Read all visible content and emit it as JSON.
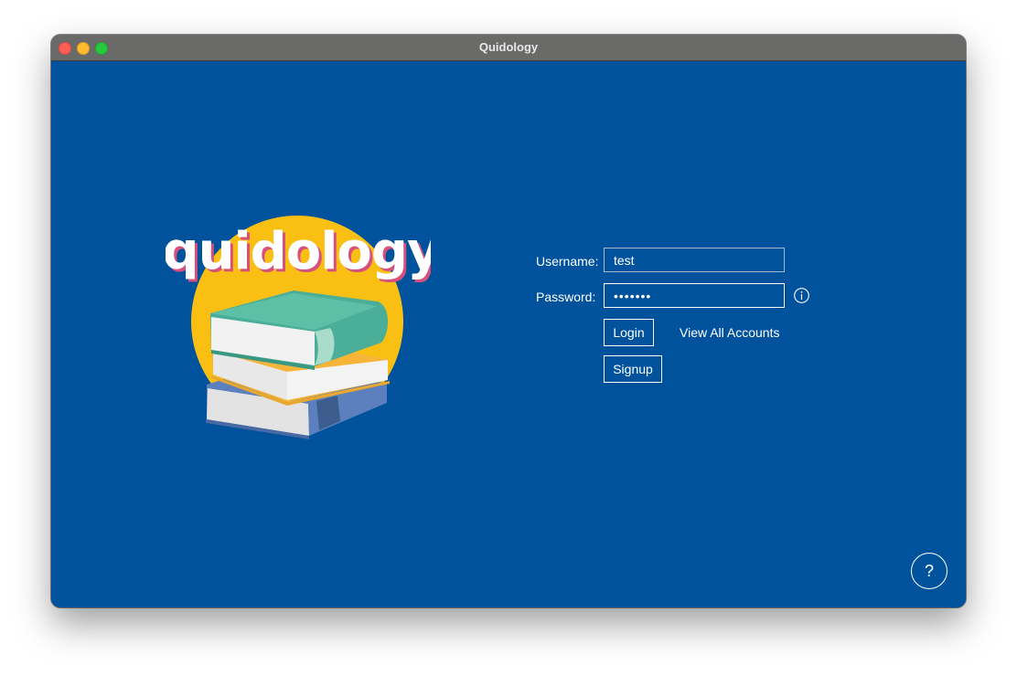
{
  "window": {
    "title": "Quidology"
  },
  "logo": {
    "wordmark": "quidology"
  },
  "login_form": {
    "username_label": "Username:",
    "username_value": "test",
    "password_label": "Password:",
    "password_value": "•••••••",
    "login_label": "Login",
    "view_accounts_label": "View All Accounts",
    "signup_label": "Signup"
  },
  "help": {
    "label": "?"
  },
  "colors": {
    "background": "#00529c",
    "titlebar": "#6a6a69",
    "logo_circle": "#f9c013",
    "book_green": "#4aae98",
    "book_blue": "#5b80bd"
  },
  "icons": {
    "info": "info-icon",
    "help": "question-icon"
  }
}
